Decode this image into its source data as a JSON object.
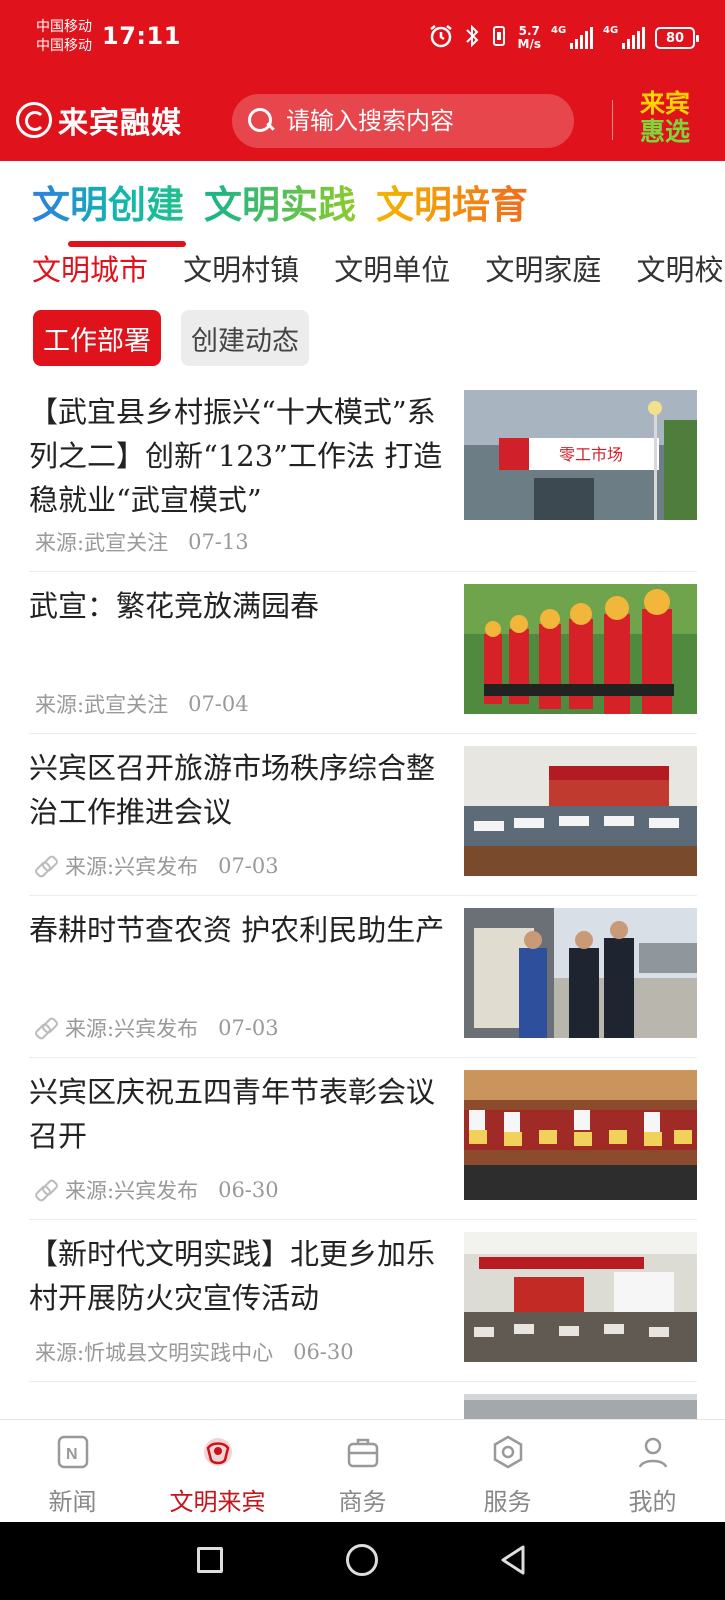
{
  "status_bar": {
    "carrier_1": "中国移动",
    "carrier_2": "中国移动",
    "time": "17:11",
    "speed_value": "5.7",
    "speed_unit": "M/s",
    "network_1": "4G",
    "network_2": "4G",
    "battery": "80"
  },
  "header": {
    "app_name": "来宾融媒",
    "search_placeholder": "请输入搜索内容",
    "promo_line1": "来宾",
    "promo_line2": "惠选"
  },
  "category_tabs": [
    "文明创建",
    "文明实践",
    "文明培育"
  ],
  "sub_tabs": [
    "文明城市",
    "文明村镇",
    "文明单位",
    "文明家庭",
    "文明校园"
  ],
  "pills": [
    "工作部署",
    "创建动态"
  ],
  "news": [
    {
      "title": "【武宜县乡村振兴“十大模式”系列之二】创新“123”工作法 打造稳就业“武宣模式”",
      "source": "来源:武宣关注",
      "date": "07-13",
      "has_link_icon": false,
      "thumb_sign": "零工市场"
    },
    {
      "title": "武宣：繁花竞放满园春",
      "source": "来源:武宣关注",
      "date": "07-04",
      "has_link_icon": false,
      "thumb_sign": ""
    },
    {
      "title": "兴宾区召开旅游市场秩序综合整治工作推进会议",
      "source": "来源:兴宾发布",
      "date": "07-03",
      "has_link_icon": true,
      "thumb_sign": ""
    },
    {
      "title": "春耕时节查农资 护农利民助生产",
      "source": "来源:兴宾发布",
      "date": "07-03",
      "has_link_icon": true,
      "thumb_sign": ""
    },
    {
      "title": "兴宾区庆祝五四青年节表彰会议召开",
      "source": "来源:兴宾发布",
      "date": "06-30",
      "has_link_icon": true,
      "thumb_sign": ""
    },
    {
      "title": "【新时代文明实践】北更乡加乐村开展防火灾宣传活动",
      "source": "来源:忻城县文明实践中心",
      "date": "06-30",
      "has_link_icon": false,
      "thumb_sign": ""
    }
  ],
  "bottom_nav": [
    {
      "label": "新闻",
      "icon": "news-icon",
      "active": false
    },
    {
      "label": "文明来宾",
      "icon": "civilization-icon",
      "active": true
    },
    {
      "label": "商务",
      "icon": "briefcase-icon",
      "active": false
    },
    {
      "label": "服务",
      "icon": "service-hexagon-icon",
      "active": false
    },
    {
      "label": "我的",
      "icon": "profile-icon",
      "active": false
    }
  ],
  "colors": {
    "brand_red": "#e0121b",
    "active_tab_red": "#c5141c"
  }
}
